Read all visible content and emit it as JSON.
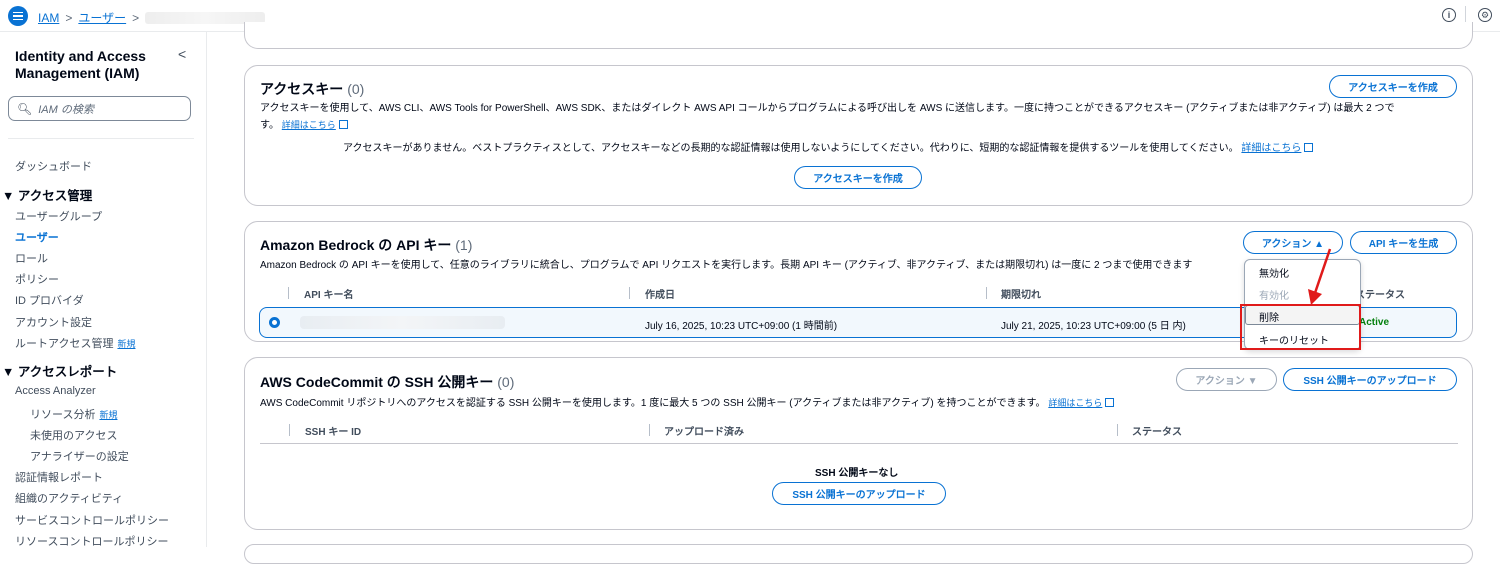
{
  "topbar": {
    "breadcrumb": [
      "IAM",
      "ユーザー"
    ],
    "separator": ">",
    "info_icon": "info-icon",
    "settings_icon": "settings-icon"
  },
  "sidebar": {
    "title": "Identity and Access Management (IAM)",
    "search_placeholder": "IAM の検索",
    "collapse_glyph": "<",
    "dashboard": "ダッシュボード",
    "access_mgmt_heading": "▼ アクセス管理",
    "access_mgmt_items": [
      "ユーザーグループ",
      "ユーザー",
      "ロール",
      "ポリシー",
      "ID プロバイダ",
      "アカウント設定",
      "ルートアクセス管理"
    ],
    "new_badge": "新規",
    "reports_heading": "▼ アクセスレポート",
    "reports_items": [
      "Access Analyzer",
      "リソース分析",
      "未使用のアクセス",
      "アナライザーの設定",
      "認証情報レポート",
      "組織のアクティビティ",
      "サービスコントロールポリシー",
      "リソースコントロールポリシー"
    ]
  },
  "access_keys": {
    "title": "アクセスキー",
    "count": "(0)",
    "create_button": "アクセスキーを作成",
    "description": "アクセスキーを使用して、AWS CLI、AWS Tools for PowerShell、AWS SDK、またはダイレクト AWS API コールからプログラムによる呼び出しを AWS に送信します。一度に持つことができるアクセスキー (アクティブまたは非アクティブ) は最大 2 つで",
    "description_cont": "す。",
    "learn_more": "詳細はこちら",
    "empty_message": "アクセスキーがありません。ベストプラクティスとして、アクセスキーなどの長期的な認証情報は使用しないようにしてください。代わりに、短期的な認証情報を提供するツールを使用してください。",
    "empty_learn_more": "詳細はこちら",
    "create_center_button": "アクセスキーを作成"
  },
  "bedrock": {
    "title": "Amazon Bedrock の API キー",
    "count": "(1)",
    "actions_button": "アクション ▲",
    "generate_button": "API キーを生成",
    "description": "Amazon Bedrock の API キーを使用して、任意のライブラリに統合し、プログラムで API リクエストを実行します。長期 API キー (アクティブ、非アクティブ、または期限切れ) は一度に 2 つまで使用できます",
    "columns": [
      "API キー名",
      "作成日",
      "期限切れ",
      "ステータス"
    ],
    "row": {
      "created": "July 16, 2025, 10:23 UTC+09:00 (1 時間前)",
      "expires": "July 21, 2025, 10:23 UTC+09:00 (5 日 内)",
      "status": "Active"
    },
    "dropdown": [
      "無効化",
      "有効化",
      "削除",
      "キーのリセット"
    ]
  },
  "codecommit": {
    "title": "AWS CodeCommit の SSH 公開キー",
    "count": "(0)",
    "actions_button": "アクション ▼",
    "upload_button": "SSH 公開キーのアップロード",
    "description": "AWS CodeCommit リポジトリへのアクセスを認証する SSH 公開キーを使用します。1 度に最大 5 つの SSH 公開キー (アクティブまたは非アクティブ) を持つことができます。",
    "learn_more": "詳細はこちら",
    "columns": [
      "SSH キー ID",
      "アップロード済み",
      "ステータス"
    ],
    "empty_message": "SSH 公開キーなし",
    "upload_center_button": "SSH 公開キーのアップロード"
  },
  "colors": {
    "link": "#0972d3",
    "active": "#037f0c",
    "highlight": "#e01a1a"
  }
}
